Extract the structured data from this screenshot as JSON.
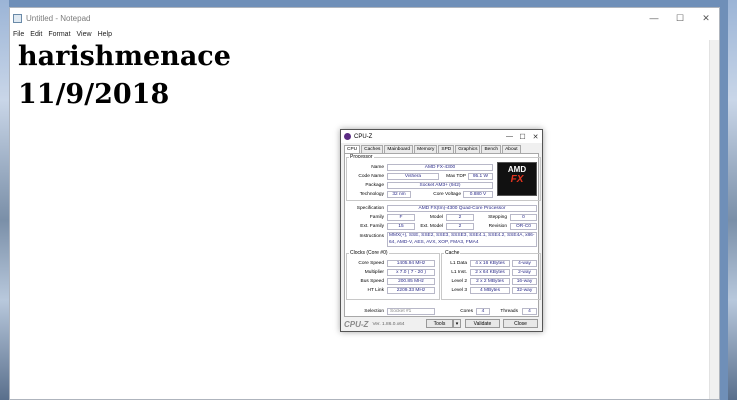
{
  "notepad": {
    "title": "Untitled - Notepad",
    "menu": [
      "File",
      "Edit",
      "Format",
      "View",
      "Help"
    ],
    "lines": [
      "harishmenace",
      "11/9/2018"
    ]
  },
  "cpuz": {
    "title": "CPU-Z",
    "tabs": [
      "CPU",
      "Caches",
      "Mainboard",
      "Memory",
      "SPD",
      "Graphics",
      "Bench",
      "About"
    ],
    "processor": {
      "legend": "Processor",
      "name_label": "Name",
      "name": "AMD FX-4300",
      "codename_label": "Code Name",
      "codename": "Vishera",
      "tdp_label": "Max TDP",
      "tdp": "95.1 W",
      "package_label": "Package",
      "package": "Socket AM3+ (942)",
      "tech_label": "Technology",
      "tech": "32 nm",
      "voltage_label": "Core Voltage",
      "voltage": "0.880 V",
      "logo_line1": "AMD",
      "logo_line2": "FX"
    },
    "spec": {
      "spec_label": "Specification",
      "spec": "AMD FX(tm)-4300 Quad-Core Processor",
      "family_label": "Family",
      "family": "F",
      "model_label": "Model",
      "model": "2",
      "stepping_label": "Stepping",
      "stepping": "0",
      "extfamily_label": "Ext. Family",
      "extfamily": "15",
      "extmodel_label": "Ext. Model",
      "extmodel": "2",
      "revision_label": "Revision",
      "revision": "OR-C0",
      "instr_label": "Instructions",
      "instr": "MMX(+), SSE, SSE2, SSE3, SSSE3, SSE4.1, SSE4.2, SSE4A, x86-64, AMD-V, AES, AVX, XOP, FMA3, FMA4"
    },
    "clocks": {
      "legend": "Clocks (Core #0)",
      "core_label": "Core Speed",
      "core": "1405.94 MHz",
      "mult_label": "Multiplier",
      "mult": "x 7.0 ( 7 - 20 )",
      "bus_label": "Bus Speed",
      "bus": "200.85 MHz",
      "ht_label": "HT Link",
      "ht": "2209.33 MHz"
    },
    "cache": {
      "legend": "Cache",
      "l1d_label": "L1 Data",
      "l1d": "4 x 16 KBytes",
      "l1d_way": "4-way",
      "l1i_label": "L1 Inst.",
      "l1i": "2 x 64 KBytes",
      "l1i_way": "2-way",
      "l2_label": "Level 2",
      "l2": "2 x 2 MBytes",
      "l2_way": "16-way",
      "l3_label": "Level 3",
      "l3": "4 MBytes",
      "l3_way": "32-way"
    },
    "bottom": {
      "selection_label": "Selection",
      "selection": "Socket #1",
      "cores_label": "Cores",
      "cores": "4",
      "threads_label": "Threads",
      "threads": "4"
    },
    "footer": {
      "brand": "CPU-Z",
      "version": "Ver. 1.86.0.x64",
      "tools": "Tools",
      "validate": "Validate",
      "close": "Close"
    }
  }
}
